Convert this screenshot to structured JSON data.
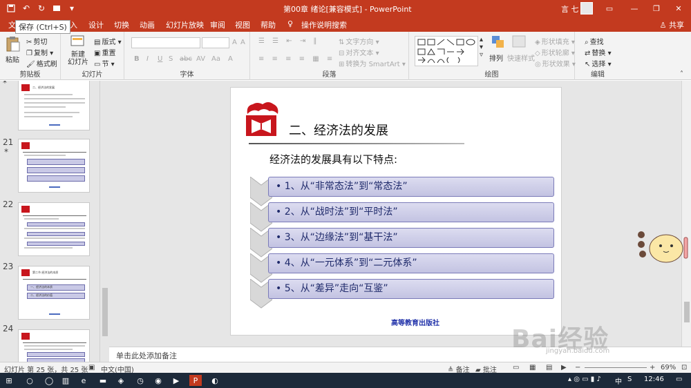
{
  "app": {
    "window_title": "第00章  绪论[兼容模式]  -  PowerPoint",
    "user": "言 七",
    "tooltip": "保存 (Ctrl+S)",
    "share": "共享",
    "menu_first": "文"
  },
  "tabs": [
    "插入",
    "设计",
    "切换",
    "动画",
    "幻灯片放映",
    "审阅",
    "视图",
    "帮助"
  ],
  "tell_me": "操作说明搜索",
  "ribbon": {
    "clipboard": {
      "label": "剪贴板",
      "paste": "粘贴",
      "cut": "剪切",
      "copy": "复制",
      "format_painter": "格式刷"
    },
    "slides": {
      "label": "幻灯片",
      "new_slide": "新建\n幻灯片",
      "layout": "版式",
      "reset": "重置",
      "section": "节"
    },
    "font": {
      "label": "字体",
      "b": "B",
      "i": "I",
      "u": "U",
      "s": "S",
      "abc": "abc",
      "av": "AV",
      "aa": "Aa",
      "a_color": "A",
      "grow": "A",
      "shrink": "A"
    },
    "paragraph": {
      "label": "段落",
      "text_direction": "文字方向",
      "align_text": "对齐文本",
      "smartart": "转换为 SmartArt"
    },
    "drawing": {
      "label": "绘图",
      "arrange": "排列",
      "quick_styles": "快速样式",
      "fill": "形状填充",
      "outline": "形状轮廓",
      "effects": "形状效果"
    },
    "editing": {
      "label": "编辑",
      "find": "查找",
      "replace": "替换",
      "select": "选择"
    }
  },
  "thumbnails": [
    {
      "num": "21",
      "star": "*"
    },
    {
      "num": "22",
      "star": ""
    },
    {
      "num": "23",
      "star": ""
    },
    {
      "num": "24",
      "star": ""
    }
  ],
  "thumb_texts": {
    "t20_top": "二、经济法的发展",
    "t23_title": "第二节  经济法的本质",
    "t23_item1": "一、经济法的本质",
    "t23_item2": "二、经济法的价值"
  },
  "slide": {
    "heading": "二、经济法的发展",
    "intro": "经济法的发展具有以下特点:",
    "items": [
      "• 1、从“非常态法”到“常态法”",
      "• 2、从“战时法”到“平时法”",
      "• 3、从“边缘法”到“基干法”",
      "• 4、从“一元体系”到“二元体系”",
      "• 5、从“差异”走向“互鉴”"
    ],
    "publisher": "高等教育出版社"
  },
  "notes_placeholder": "单击此处添加备注",
  "status": {
    "slide_count": "幻灯片 第 25 张，共 25 张",
    "language": "中文(中国)",
    "notes": "备注",
    "comments": "批注",
    "zoom": "69%"
  },
  "taskbar": {
    "time": "12:46",
    "ime": "中"
  },
  "watermark": {
    "text": "Bai经验",
    "sub": "jingyan.baidu.com"
  },
  "colors": {
    "titlebar": "#c33a1f",
    "slide_box": "#c9c9e6",
    "slide_box_border": "#7a7ab8",
    "publisher": "#2233aa"
  }
}
